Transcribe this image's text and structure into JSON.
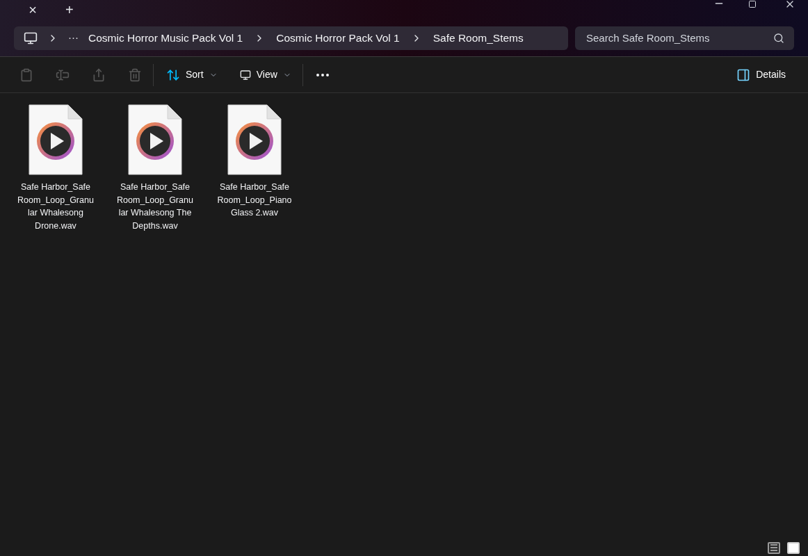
{
  "tab_strip": {
    "close_tab": "×",
    "new_tab": "+"
  },
  "address_bar": {
    "overflow": "···",
    "crumbs": [
      {
        "label": "Cosmic Horror Music Pack Vol 1"
      },
      {
        "label": "Cosmic Horror Pack Vol 1"
      },
      {
        "label": "Safe Room_Stems"
      }
    ]
  },
  "search": {
    "placeholder": "Search Safe Room_Stems"
  },
  "toolbar": {
    "actions": [
      {
        "kind": "copy",
        "disabled": true
      },
      {
        "kind": "rename",
        "disabled": true
      },
      {
        "kind": "share",
        "disabled": true
      },
      {
        "kind": "delete",
        "disabled": true
      }
    ],
    "sort": "Sort",
    "view": "View",
    "details": "Details"
  },
  "files": [
    {
      "lines": [
        "Safe Harbor_Safe",
        "Room_Loop_Granu",
        "lar Whalesong",
        "Drone.wav"
      ]
    },
    {
      "lines": [
        "Safe Harbor_Safe",
        "Room_Loop_Granu",
        "lar Whalesong The",
        "Depths.wav"
      ]
    },
    {
      "lines": [
        "Safe Harbor_Safe",
        "Room_Loop_Piano",
        "Glass 2.wav"
      ]
    }
  ],
  "view_toggles": [
    {
      "kind": "details",
      "selected": false
    },
    {
      "kind": "large_icons",
      "selected": true
    }
  ]
}
